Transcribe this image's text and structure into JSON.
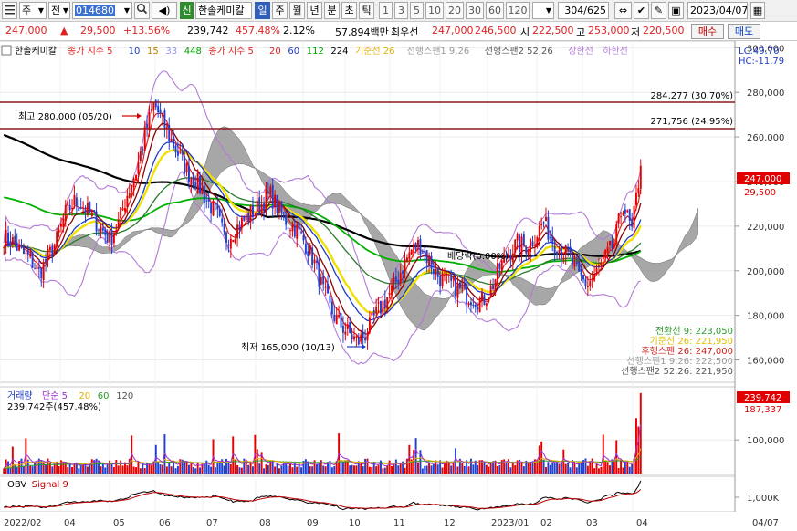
{
  "toolbar": {
    "menu_icon": "list-icon",
    "period_select": "주",
    "view_select": "전",
    "code": "014680",
    "name_badge": "신",
    "stock_name": "한솔케미칼",
    "period_tabs": [
      "일",
      "주",
      "월",
      "년",
      "분",
      "초",
      "틱"
    ],
    "active_period": "일",
    "interval_buttons": [
      "1",
      "3",
      "5",
      "10",
      "20",
      "30",
      "60",
      "120"
    ],
    "count": "304",
    "total": "/625",
    "date": "2023/04/07"
  },
  "quote": {
    "price": "247,000",
    "arrow": "▲",
    "change": "29,500",
    "rate": "+13.56%",
    "volume": "239,742",
    "vol_ratio": "457.48%",
    "turnover_rate": "2.12%",
    "amount": "57,894백만",
    "best_ask_label": "최우선",
    "best_ask": "247,000",
    "best_bid": "246,500",
    "open_label": "시",
    "open": "222,500",
    "high_label": "고",
    "high": "253,000",
    "low_label": "저",
    "low": "220,500",
    "buy_label": "매수",
    "sell_label": "매도"
  },
  "colors": {
    "up": "#e60000",
    "down": "#1f3fd0",
    "bollinger": "#b27ad6",
    "cloud": "#8a8a8a",
    "ma5": "#e02020",
    "ma10": "#1e3cc8",
    "ma15": "#ffb000",
    "ma33": "#a0a0ff",
    "ma448": "#00b000",
    "conversion": "#3aa040",
    "lagging": "#f0e000"
  },
  "main_legend": [
    {
      "text": "한솔케미칼",
      "color": "#000000"
    },
    {
      "text": "종가 지수 5",
      "color": "#e02020"
    },
    {
      "text": "10",
      "color": "#1e3cc8"
    },
    {
      "text": "15",
      "color": "#c08000"
    },
    {
      "text": "33",
      "color": "#9090ff"
    },
    {
      "text": "448",
      "color": "#00a000"
    },
    {
      "text": "종가 지수 5",
      "color": "#e02020"
    },
    {
      "text": "20",
      "color": "#e02020"
    },
    {
      "text": "60",
      "color": "#1e3cc8"
    },
    {
      "text": "112",
      "color": "#00a000"
    },
    {
      "text": "224",
      "color": "#000000"
    },
    {
      "text": "기준선 26",
      "color": "#e0b000"
    },
    {
      "text": "선행스팬1 9,26",
      "color": "#999999"
    },
    {
      "text": "선행스팬2 52,26",
      "color": "#555555"
    },
    {
      "text": "상한선",
      "color": "#b27ad6"
    },
    {
      "text": "하한선",
      "color": "#b27ad6"
    }
  ],
  "overlays": {
    "lc": "LC:49.70",
    "hc": "HC:-11.79",
    "hline_upper": "284,277 (30.70%)",
    "hline_lower": "271,756 (24.95%)",
    "high_marker": "최고 280,000 (05/20)",
    "low_marker": "최저 165,000 (10/13)",
    "event_label": "배당락(0.00%)",
    "price_tag": "247,000",
    "change_tag": "29,500"
  },
  "ichimoku_legend": [
    {
      "text": "전환선 9: 223,050",
      "color": "#2a9d2a"
    },
    {
      "text": "기준선 26: 221,950",
      "color": "#e0c000"
    },
    {
      "text": "후행스팬 26: 247,000",
      "color": "#d02020"
    },
    {
      "text": "선행스팬1 9,26: 222,500",
      "color": "#999999"
    },
    {
      "text": "선행스팬2 52,26: 221,950",
      "color": "#555555"
    }
  ],
  "volume_legend": [
    {
      "text": "거래량",
      "color": "#1e3cc8"
    },
    {
      "text": "단순 5",
      "color": "#9b30d0"
    },
    {
      "text": "20",
      "color": "#e0b000"
    },
    {
      "text": "60",
      "color": "#2a9d2a"
    },
    {
      "text": "120",
      "color": "#555555"
    }
  ],
  "volume_summary": "239,742주(457.48%)",
  "volume_tags": [
    "239,742",
    "187,337"
  ],
  "obv_legend": [
    {
      "text": "OBV",
      "color": "#000000"
    },
    {
      "text": "Signal 9",
      "color": "#c00000"
    }
  ],
  "chart_data": [
    {
      "type": "candlestick",
      "title": "한솔케미칼",
      "x_tick_labels": [
        "2022/02",
        "04",
        "05",
        "06",
        "07",
        "08",
        "09",
        "10",
        "11",
        "12",
        "2023/01",
        "02",
        "03",
        "04",
        "04/07"
      ],
      "y_tick_labels": [
        "300,000",
        "280,000",
        "260,000",
        "240,000",
        "220,000",
        "200,000",
        "180,000",
        "160,000"
      ],
      "ylim": [
        150000,
        303000
      ],
      "series_close": [
        {
          "month": "2022/02",
          "values": [
            215000,
            213000,
            208000,
            205000,
            199000
          ]
        },
        {
          "month": "03",
          "values": [
            206000,
            214000,
            226000,
            231000,
            229000
          ]
        },
        {
          "month": "04",
          "values": [
            224000,
            219000,
            214000,
            222000,
            235000
          ]
        },
        {
          "month": "05",
          "values": [
            245000,
            262000,
            275000,
            266000,
            258000
          ]
        },
        {
          "month": "06",
          "values": [
            250000,
            243000,
            239000,
            231000,
            226000
          ]
        },
        {
          "month": "07",
          "values": [
            214000,
            218000,
            222000,
            226000,
            229000
          ]
        },
        {
          "month": "08",
          "values": [
            235000,
            228000,
            222000,
            219000,
            213000
          ]
        },
        {
          "month": "09",
          "values": [
            205000,
            192000,
            182000,
            176000,
            172000
          ]
        },
        {
          "month": "10",
          "values": [
            168000,
            172000,
            180000,
            186000,
            192000
          ]
        },
        {
          "month": "11",
          "values": [
            201000,
            209000,
            212000,
            205000,
            198000
          ]
        },
        {
          "month": "12",
          "values": [
            195000,
            193000,
            190000,
            188000,
            186000
          ]
        },
        {
          "month": "2023/01",
          "values": [
            191000,
            201000,
            208000,
            212000,
            211000
          ]
        },
        {
          "month": "02",
          "values": [
            215000,
            222000,
            214000,
            209000,
            206000
          ]
        },
        {
          "month": "03",
          "values": [
            197000,
            194000,
            199000,
            206000,
            212000
          ]
        },
        {
          "month": "04",
          "values": [
            230000,
            217500,
            247000
          ]
        }
      ],
      "annotations": [
        {
          "label": "최고 280,000 (05/20)",
          "value": 280000
        },
        {
          "label": "최저 165,000 (10/13)",
          "value": 165000
        },
        {
          "label": "284,277 (30.70%)",
          "value": 284277
        },
        {
          "label": "271,756 (24.95%)",
          "value": 271756
        }
      ]
    },
    {
      "type": "bar",
      "title": "거래량",
      "y_tick_labels": [
        "100,000"
      ],
      "ylim": [
        0,
        250000
      ],
      "last_values": [
        239742,
        187337
      ]
    },
    {
      "type": "line",
      "title": "OBV",
      "y_tick_labels": [
        "1,000K"
      ]
    }
  ]
}
